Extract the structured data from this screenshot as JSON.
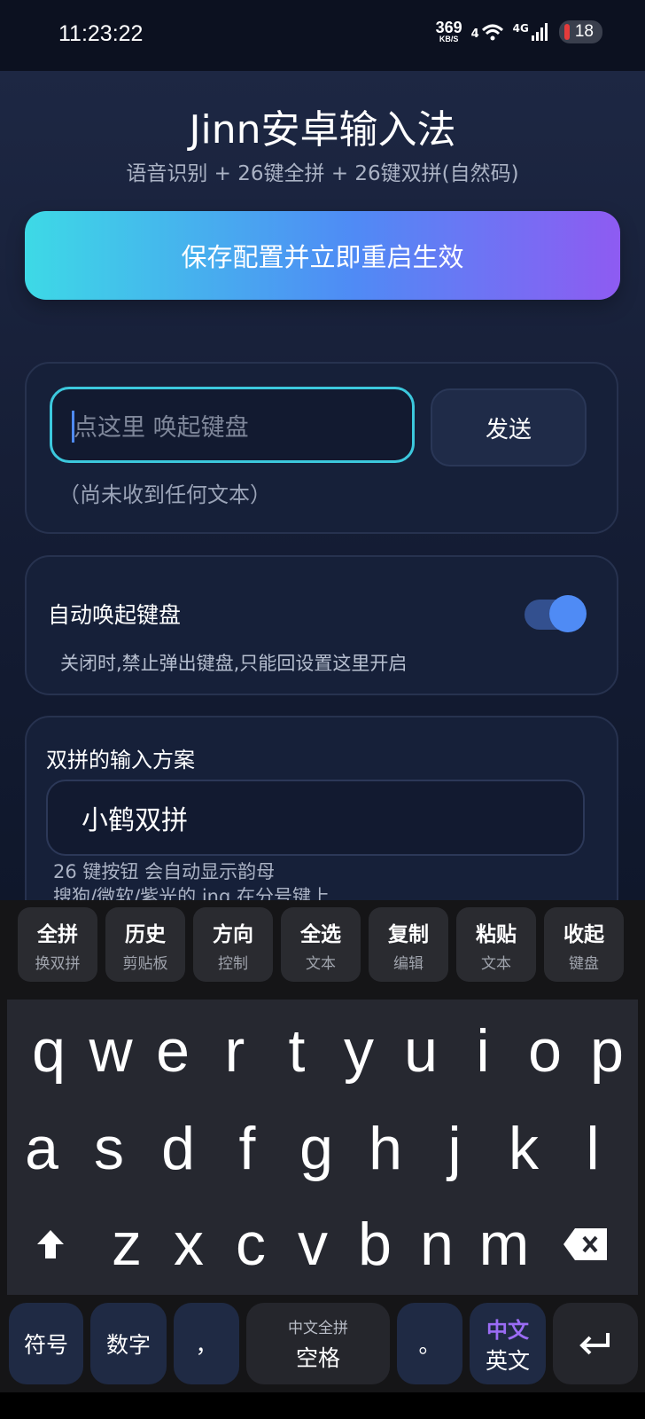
{
  "status": {
    "time": "11:23:22",
    "net_speed": "369",
    "net_unit": "KB/S",
    "wifi": "4",
    "signal": "4G",
    "battery": "18",
    "wifi_icon": "wifi-icon",
    "signal_icon": "cell-signal-icon"
  },
  "app": {
    "title": "Jinn安卓输入法",
    "subtitle": "语音识别 + 26键全拼 + 26键双拼(自然码)",
    "save_button": "保存配置并立即重启生效",
    "input": {
      "placeholder": "点这里 唤起键盘",
      "send": "发送"
    },
    "received_text": "（尚未收到任何文本）",
    "auto_keyboard": {
      "label": "自动唤起键盘",
      "enabled": true,
      "desc": "关闭时,禁止弹出键盘,只能回设置这里开启"
    },
    "scheme": {
      "label": "双拼的输入方案",
      "value": "小鹤双拼",
      "note1": "26 键按钮 会自动显示韵母",
      "note2": "搜狗/微软/紫光的 ing 在分号键上"
    }
  },
  "keyboard": {
    "func_keys": [
      {
        "top": "全拼",
        "sub": "换双拼"
      },
      {
        "top": "历史",
        "sub": "剪贴板"
      },
      {
        "top": "方向",
        "sub": "控制"
      },
      {
        "top": "全选",
        "sub": "文本"
      },
      {
        "top": "复制",
        "sub": "编辑"
      },
      {
        "top": "粘贴",
        "sub": "文本"
      },
      {
        "top": "收起",
        "sub": "键盘"
      }
    ],
    "row1": [
      "q",
      "w",
      "e",
      "r",
      "t",
      "y",
      "u",
      "i",
      "o",
      "p"
    ],
    "row2": [
      "a",
      "s",
      "d",
      "f",
      "g",
      "h",
      "j",
      "k",
      "l"
    ],
    "row3": [
      "z",
      "x",
      "c",
      "v",
      "b",
      "n",
      "m"
    ],
    "bottom": {
      "symbols": "符号",
      "numbers": "数字",
      "comma": "，",
      "space_top": "中文全拼",
      "space": "空格",
      "period": "。",
      "lang_top": "中文",
      "lang_bottom": "英文"
    },
    "icons": {
      "shift": "shift-arrow-icon",
      "backspace": "backspace-icon",
      "enter": "enter-arrow-icon"
    }
  }
}
